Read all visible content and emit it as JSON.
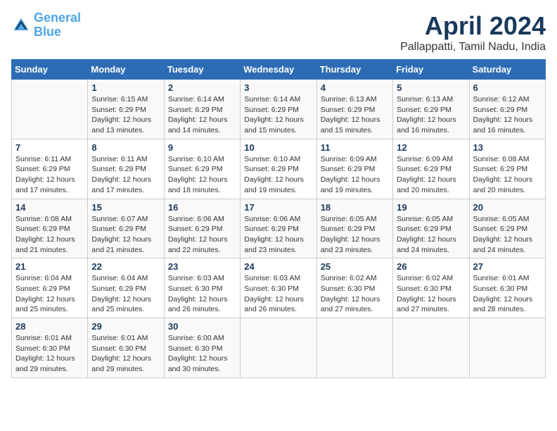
{
  "header": {
    "logo_line1": "General",
    "logo_line2": "Blue",
    "month_year": "April 2024",
    "location": "Pallappatti, Tamil Nadu, India"
  },
  "weekdays": [
    "Sunday",
    "Monday",
    "Tuesday",
    "Wednesday",
    "Thursday",
    "Friday",
    "Saturday"
  ],
  "weeks": [
    [
      {
        "num": "",
        "info": ""
      },
      {
        "num": "1",
        "info": "Sunrise: 6:15 AM\nSunset: 6:29 PM\nDaylight: 12 hours\nand 13 minutes."
      },
      {
        "num": "2",
        "info": "Sunrise: 6:14 AM\nSunset: 6:29 PM\nDaylight: 12 hours\nand 14 minutes."
      },
      {
        "num": "3",
        "info": "Sunrise: 6:14 AM\nSunset: 6:29 PM\nDaylight: 12 hours\nand 15 minutes."
      },
      {
        "num": "4",
        "info": "Sunrise: 6:13 AM\nSunset: 6:29 PM\nDaylight: 12 hours\nand 15 minutes."
      },
      {
        "num": "5",
        "info": "Sunrise: 6:13 AM\nSunset: 6:29 PM\nDaylight: 12 hours\nand 16 minutes."
      },
      {
        "num": "6",
        "info": "Sunrise: 6:12 AM\nSunset: 6:29 PM\nDaylight: 12 hours\nand 16 minutes."
      }
    ],
    [
      {
        "num": "7",
        "info": "Sunrise: 6:11 AM\nSunset: 6:29 PM\nDaylight: 12 hours\nand 17 minutes."
      },
      {
        "num": "8",
        "info": "Sunrise: 6:11 AM\nSunset: 6:29 PM\nDaylight: 12 hours\nand 17 minutes."
      },
      {
        "num": "9",
        "info": "Sunrise: 6:10 AM\nSunset: 6:29 PM\nDaylight: 12 hours\nand 18 minutes."
      },
      {
        "num": "10",
        "info": "Sunrise: 6:10 AM\nSunset: 6:29 PM\nDaylight: 12 hours\nand 19 minutes."
      },
      {
        "num": "11",
        "info": "Sunrise: 6:09 AM\nSunset: 6:29 PM\nDaylight: 12 hours\nand 19 minutes."
      },
      {
        "num": "12",
        "info": "Sunrise: 6:09 AM\nSunset: 6:29 PM\nDaylight: 12 hours\nand 20 minutes."
      },
      {
        "num": "13",
        "info": "Sunrise: 6:08 AM\nSunset: 6:29 PM\nDaylight: 12 hours\nand 20 minutes."
      }
    ],
    [
      {
        "num": "14",
        "info": "Sunrise: 6:08 AM\nSunset: 6:29 PM\nDaylight: 12 hours\nand 21 minutes."
      },
      {
        "num": "15",
        "info": "Sunrise: 6:07 AM\nSunset: 6:29 PM\nDaylight: 12 hours\nand 21 minutes."
      },
      {
        "num": "16",
        "info": "Sunrise: 6:06 AM\nSunset: 6:29 PM\nDaylight: 12 hours\nand 22 minutes."
      },
      {
        "num": "17",
        "info": "Sunrise: 6:06 AM\nSunset: 6:29 PM\nDaylight: 12 hours\nand 23 minutes."
      },
      {
        "num": "18",
        "info": "Sunrise: 6:05 AM\nSunset: 6:29 PM\nDaylight: 12 hours\nand 23 minutes."
      },
      {
        "num": "19",
        "info": "Sunrise: 6:05 AM\nSunset: 6:29 PM\nDaylight: 12 hours\nand 24 minutes."
      },
      {
        "num": "20",
        "info": "Sunrise: 6:05 AM\nSunset: 6:29 PM\nDaylight: 12 hours\nand 24 minutes."
      }
    ],
    [
      {
        "num": "21",
        "info": "Sunrise: 6:04 AM\nSunset: 6:29 PM\nDaylight: 12 hours\nand 25 minutes."
      },
      {
        "num": "22",
        "info": "Sunrise: 6:04 AM\nSunset: 6:29 PM\nDaylight: 12 hours\nand 25 minutes."
      },
      {
        "num": "23",
        "info": "Sunrise: 6:03 AM\nSunset: 6:30 PM\nDaylight: 12 hours\nand 26 minutes."
      },
      {
        "num": "24",
        "info": "Sunrise: 6:03 AM\nSunset: 6:30 PM\nDaylight: 12 hours\nand 26 minutes."
      },
      {
        "num": "25",
        "info": "Sunrise: 6:02 AM\nSunset: 6:30 PM\nDaylight: 12 hours\nand 27 minutes."
      },
      {
        "num": "26",
        "info": "Sunrise: 6:02 AM\nSunset: 6:30 PM\nDaylight: 12 hours\nand 27 minutes."
      },
      {
        "num": "27",
        "info": "Sunrise: 6:01 AM\nSunset: 6:30 PM\nDaylight: 12 hours\nand 28 minutes."
      }
    ],
    [
      {
        "num": "28",
        "info": "Sunrise: 6:01 AM\nSunset: 6:30 PM\nDaylight: 12 hours\nand 29 minutes."
      },
      {
        "num": "29",
        "info": "Sunrise: 6:01 AM\nSunset: 6:30 PM\nDaylight: 12 hours\nand 29 minutes."
      },
      {
        "num": "30",
        "info": "Sunrise: 6:00 AM\nSunset: 6:30 PM\nDaylight: 12 hours\nand 30 minutes."
      },
      {
        "num": "",
        "info": ""
      },
      {
        "num": "",
        "info": ""
      },
      {
        "num": "",
        "info": ""
      },
      {
        "num": "",
        "info": ""
      }
    ]
  ]
}
